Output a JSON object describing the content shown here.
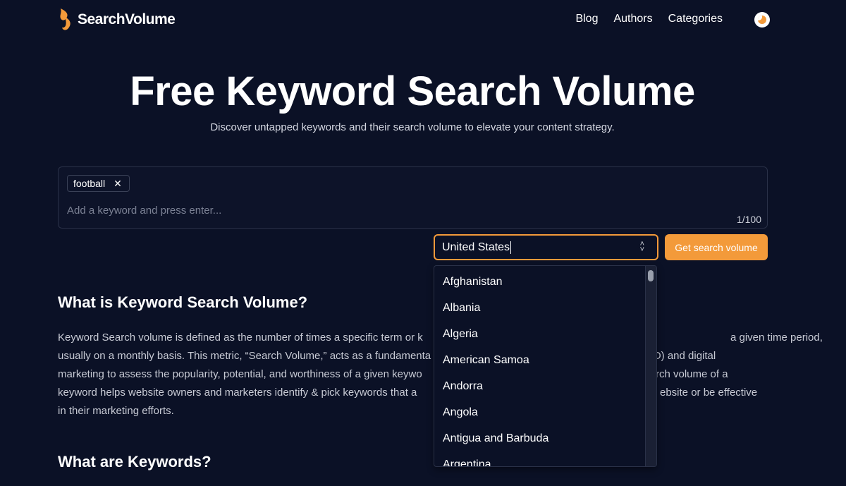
{
  "header": {
    "brand": "SearchVolume",
    "nav": [
      "Blog",
      "Authors",
      "Categories"
    ]
  },
  "hero": {
    "title": "Free Keyword Search Volume",
    "subtitle": "Discover untapped keywords and their search volume to elevate your content strategy."
  },
  "keyword_box": {
    "chips": [
      "football"
    ],
    "placeholder": "Add a keyword and press enter...",
    "counter": "1/100"
  },
  "country": {
    "selected": "United States",
    "options": [
      "Afghanistan",
      "Albania",
      "Algeria",
      "American Samoa",
      "Andorra",
      "Angola",
      "Antigua and Barbuda",
      "Argentina"
    ]
  },
  "actions": {
    "submit_label": "Get search volume"
  },
  "content": {
    "section1_title": "What is Keyword Search Volume?",
    "section1_lines": [
      "Keyword Search volume is defined as the number of times a specific term or k",
      "usually on a monthly basis. This metric, “Search Volume,” acts as a fundamenta",
      "marketing to assess the popularity, potential, and worthiness of a given keywo",
      "keyword helps website owners and marketers identify & pick keywords that a",
      "in their marketing efforts."
    ],
    "section1_lines_right": [
      "a given time period,",
      "O) and digital",
      "rch volume of a",
      "ebsite or be effective",
      ""
    ],
    "section2_title": "What are Keywords?"
  },
  "colors": {
    "background": "#0b1126",
    "accent": "#f39a3a"
  }
}
